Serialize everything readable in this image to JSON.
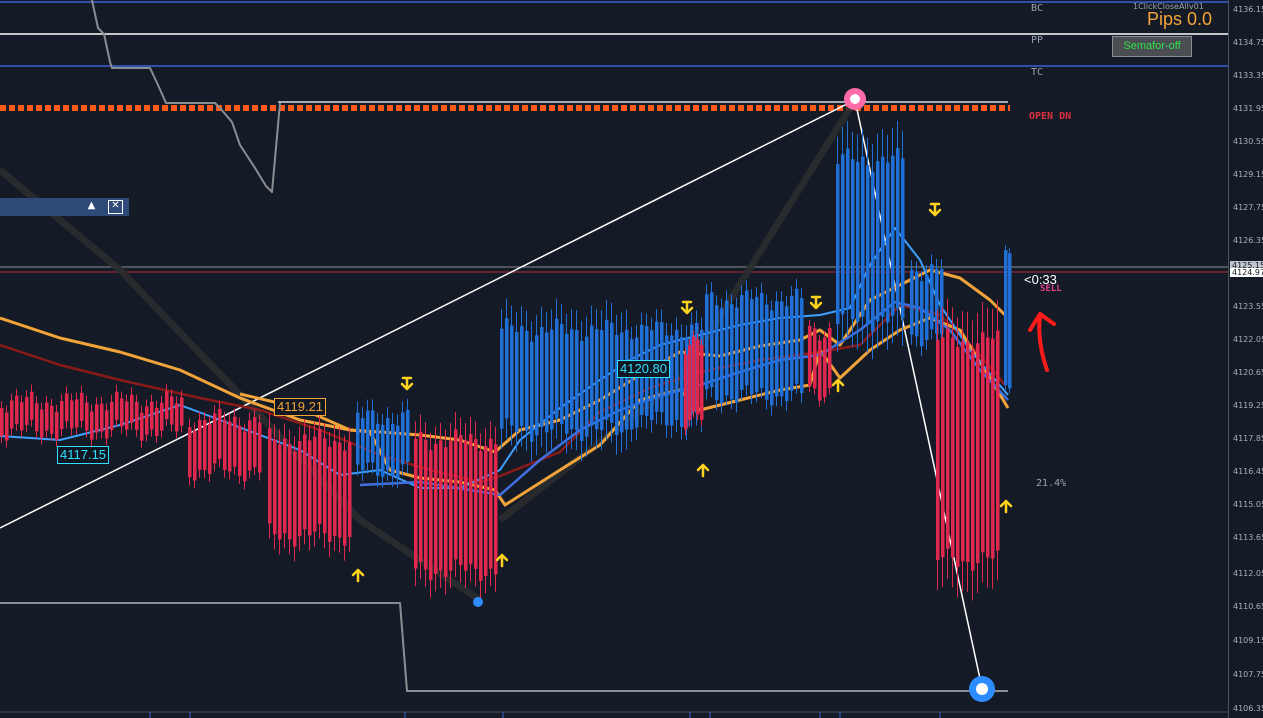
{
  "indicator_panel": {
    "title": "1ClickCloseAllv01",
    "pips_text": "Pips 0.0",
    "semafor_button": "Semafor-off"
  },
  "pivot_labels": {
    "bc": "BC",
    "pp": "PP",
    "tc": "TC"
  },
  "open_signal": "OPEN DN",
  "countdown": "<0:33",
  "signal_text": "SELL",
  "percent_text": "21.4%",
  "price_labels": [
    "4117.15",
    "4119.21",
    "4120.80"
  ],
  "price_axis": {
    "ticks": [
      "4136.15",
      "4134.75",
      "4133.35",
      "4131.95",
      "4130.55",
      "4129.15",
      "4127.75",
      "4126.35",
      "4123.55",
      "4122.05",
      "4120.65",
      "4119.25",
      "4117.85",
      "4116.45",
      "4115.05",
      "4113.65",
      "4112.05",
      "4110.65",
      "4109.15",
      "4107.75",
      "4106.35"
    ],
    "current_ask": "4125.15",
    "current_bid": "4124.97"
  },
  "mini_panel": {
    "up_icon": "▲",
    "close_icon": "✕"
  },
  "colors": {
    "background": "#141b26",
    "bull_candle": "#1f6fd6",
    "bear_candle": "#e0284e",
    "envelope": "#f2a33a",
    "ma_dark_red": "#8a1a1a",
    "fast_ma": "#3fa0ff",
    "slow_ma": "#4070e0",
    "zigzag": "#ffffff",
    "open_line": "#ff5a1a",
    "pivot_blue": "#3a62d8",
    "arrow_yellow": "#ffd21e",
    "annotation_red": "#ff1a1a"
  }
}
